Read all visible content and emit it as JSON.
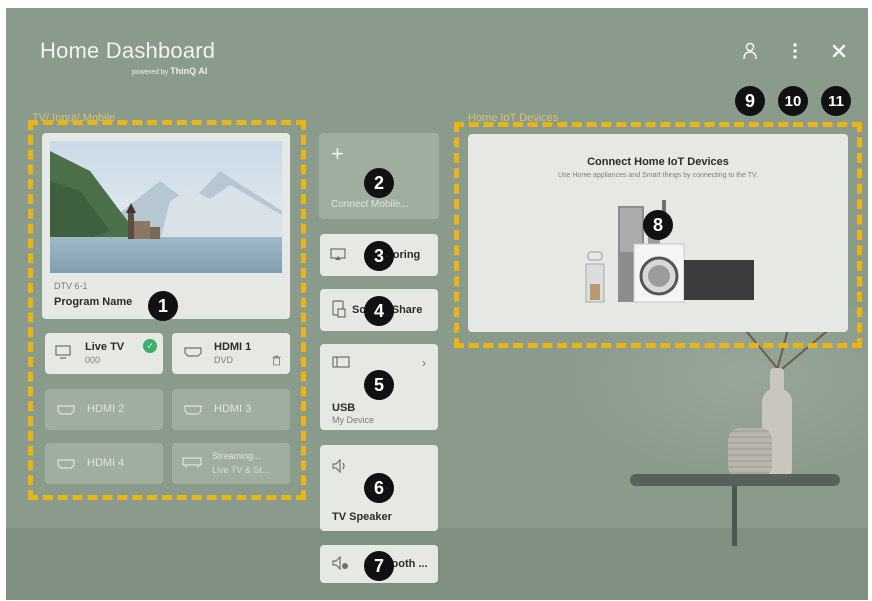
{
  "header": {
    "title": "Home Dashboard",
    "powered_prefix": "powered by",
    "powered_brand": "ThinQ AI"
  },
  "sections": {
    "inputs_label": "TV/ Input/ Mobile",
    "iot_label": "Home IoT Devices"
  },
  "program": {
    "channel": "DTV 6-1",
    "name": "Program Name"
  },
  "inputs": [
    {
      "name": "Live TV",
      "sub": "000",
      "icon": "tv-icon",
      "active": true,
      "selected": true
    },
    {
      "name": "HDMI 1",
      "sub": "DVD",
      "icon": "hdmi-icon",
      "active": true,
      "selected": false
    },
    {
      "name": "HDMI 2",
      "sub": "",
      "icon": "hdmi-icon",
      "active": false
    },
    {
      "name": "HDMI 3",
      "sub": "",
      "icon": "hdmi-icon",
      "active": false
    },
    {
      "name": "HDMI 4",
      "sub": "",
      "icon": "hdmi-icon",
      "active": false
    },
    {
      "name": "Streaming...",
      "sub": "Live TV & St...",
      "icon": "streaming-icon",
      "active": false
    }
  ],
  "middle": {
    "connect_mobile": "Connect Mobile...",
    "mirroring": "Mirroring",
    "screen_share": "Screen Share",
    "usb_title": "USB",
    "usb_sub": "My Device",
    "tv_speaker": "TV Speaker",
    "bluetooth": "Bluetooth ..."
  },
  "iot": {
    "title": "Connect Home IoT Devices",
    "description": "Use Home appliances and Smart things by connecting to the TV."
  },
  "badges": [
    "1",
    "2",
    "3",
    "4",
    "5",
    "6",
    "7",
    "8",
    "9",
    "10",
    "11"
  ],
  "colors": {
    "background": "#8a9a8b",
    "highlight": "#e8b418",
    "tile": "#e6e8e4",
    "check": "#3fae6b"
  }
}
